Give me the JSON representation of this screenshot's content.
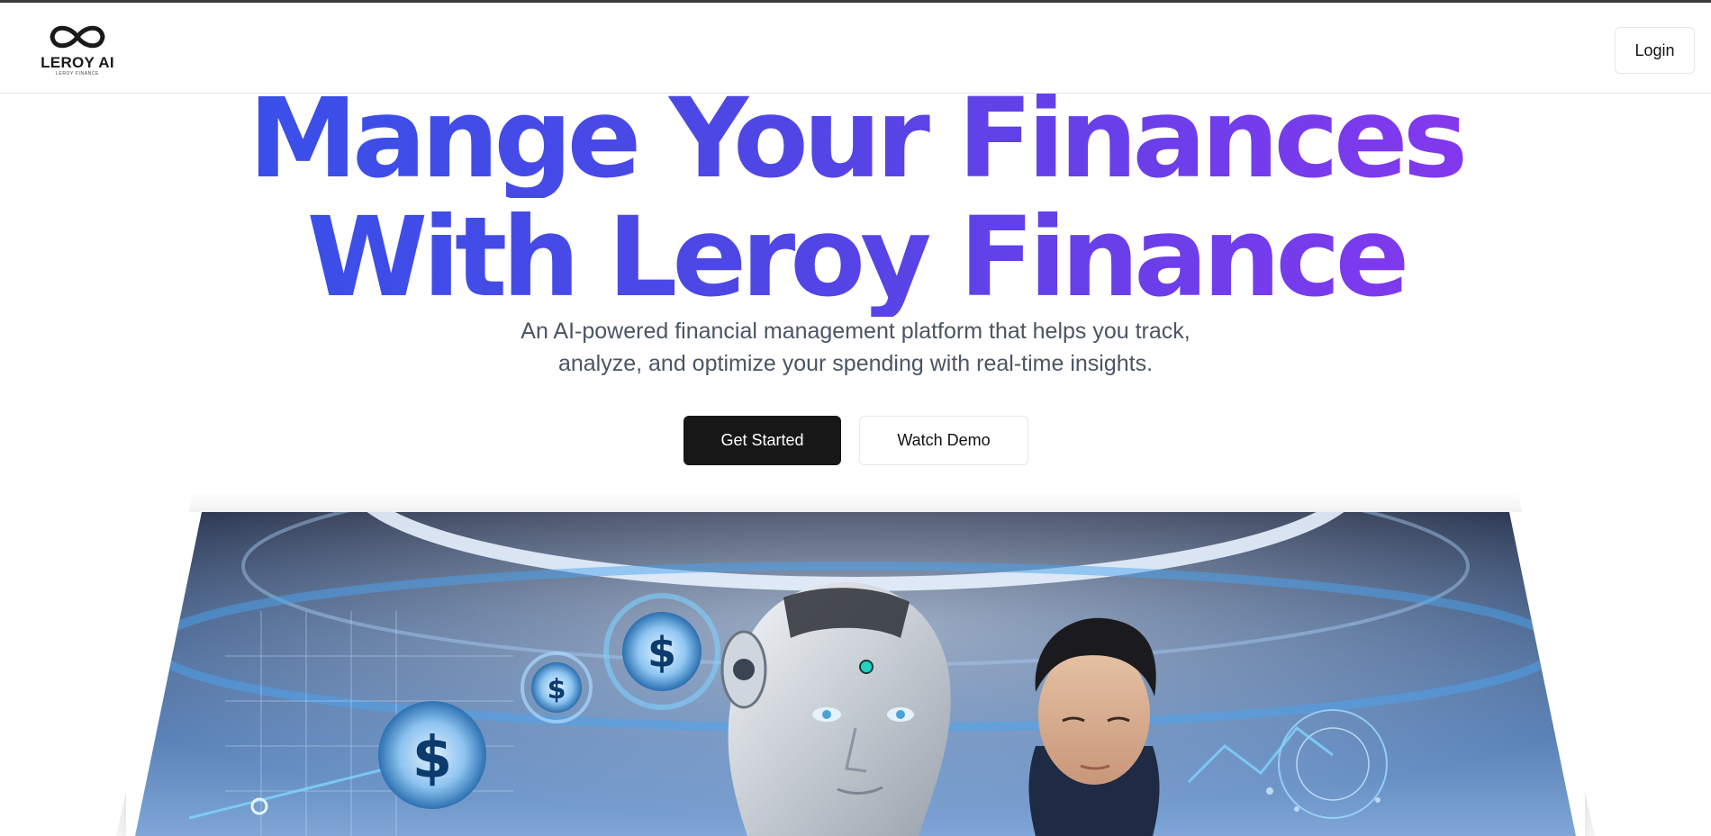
{
  "header": {
    "logo_title": "LEROY AI",
    "logo_subtitle": "LEROY FINANCE",
    "login_label": "Login"
  },
  "hero": {
    "title_line1": "Mange Your Finances",
    "title_line2": "With Leroy Finance",
    "subtitle_line1": "An AI-powered financial management platform that helps you track,",
    "subtitle_line2": "analyze, and optimize your spending with real-time insights.",
    "primary_button": "Get Started",
    "secondary_button": "Watch Demo"
  },
  "colors": {
    "gradient_start": "#2f54eb",
    "gradient_end": "#9333ea",
    "primary_button_bg": "#171717"
  },
  "icons": [
    "infinity-logo-icon",
    "dollar-coin-icon"
  ]
}
